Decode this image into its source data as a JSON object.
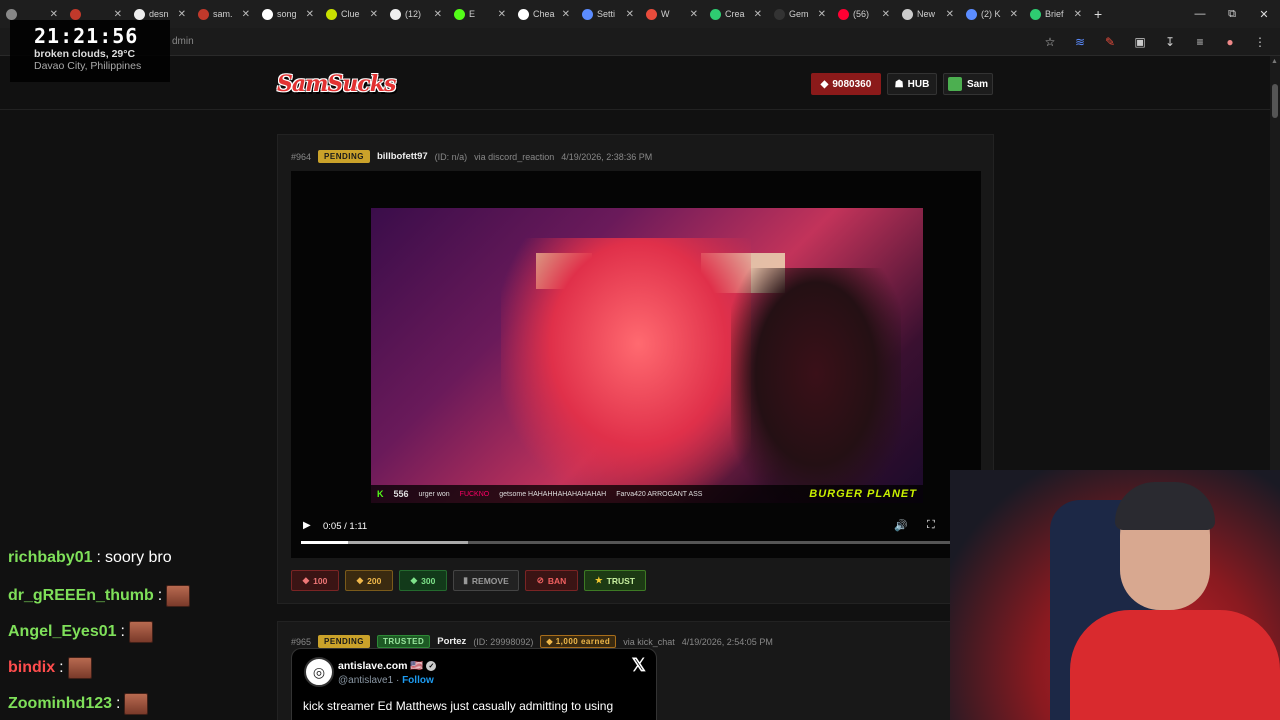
{
  "browser": {
    "tabs": [
      {
        "label": "",
        "color": "#888888"
      },
      {
        "label": "",
        "color": "#c0392b"
      },
      {
        "label": "desn",
        "color": "#eeeeee"
      },
      {
        "label": "sam.",
        "color": "#c0392b"
      },
      {
        "label": "song",
        "color": "#ffffff"
      },
      {
        "label": "Clue",
        "color": "#c8e000"
      },
      {
        "label": "(12)",
        "color": "#eeeeee"
      },
      {
        "label": "E",
        "color": "#53fc18"
      },
      {
        "label": "Chea",
        "color": "#ffffff"
      },
      {
        "label": "Setti",
        "color": "#5b8cff"
      },
      {
        "label": "W",
        "color": "#e74c3c"
      },
      {
        "label": "Crea",
        "color": "#2ecc71"
      },
      {
        "label": "Gem",
        "color": "#333333"
      },
      {
        "label": "(56)",
        "color": "#ff0033"
      },
      {
        "label": "New",
        "color": "#cccccc"
      },
      {
        "label": "(2) K",
        "color": "#5b8cff"
      },
      {
        "label": "Brief",
        "color": "#2ecc71"
      }
    ],
    "new_tab_label": "+",
    "url": "dmin"
  },
  "clock": {
    "time": "21:21:56",
    "weather": "broken clouds, 29°C",
    "location": "Davao City, Philippines"
  },
  "header": {
    "logo_text": "SamSucks",
    "points": "9080360",
    "hub_label": "HUB",
    "user_label": "Sam"
  },
  "submissions": [
    {
      "id": "#964",
      "status": "PENDING",
      "username": "billbofett97",
      "user_id": "(ID: n/a)",
      "source": "via discord_reaction",
      "timestamp": "4/19/2026, 2:38:36 PM",
      "video": {
        "time": "0:05 / 1:11",
        "progress_fraction": 0.07,
        "buffered_fraction": 0.25,
        "overlay": {
          "viewers": "556",
          "text1": "urger won",
          "text2": "FUCKNO",
          "text3": "getsome HAHAHHAHAHAHAHAH",
          "text4": "Farva420 ARROGANT ASS",
          "brand": "BURGER PLANET"
        }
      },
      "actions": {
        "a100": "100",
        "a200": "200",
        "a300": "300",
        "remove": "REMOVE",
        "ban": "BAN",
        "trust": "TRUST"
      }
    },
    {
      "id": "#965",
      "status": "PENDING",
      "trusted": "TRUSTED",
      "username": "Portez",
      "user_id": "(ID: 29998092)",
      "earned": "1,000 earned",
      "source": "via kick_chat",
      "timestamp": "4/19/2026, 2:54:05 PM",
      "tweet": {
        "name": "antislave.com 🇺🇸",
        "handle": "@antislave1",
        "follow": "Follow",
        "text": "kick streamer Ed Matthews just casually admitting to using"
      }
    }
  ],
  "chat": [
    {
      "user": "richbaby01",
      "color": "#7fe05a",
      "text": "soory bro",
      "emote": false
    },
    {
      "user": "dr_gREEEn_thumb",
      "color": "#7fe05a",
      "text": "",
      "emote": true
    },
    {
      "user": "Angel_Eyes01",
      "color": "#7fe05a",
      "text": "",
      "emote": true
    },
    {
      "user": "bindix",
      "color": "#ff4d4d",
      "text": "",
      "emote": true
    },
    {
      "user": "Zoominhd123",
      "color": "#7fe05a",
      "text": "",
      "emote": true
    }
  ]
}
